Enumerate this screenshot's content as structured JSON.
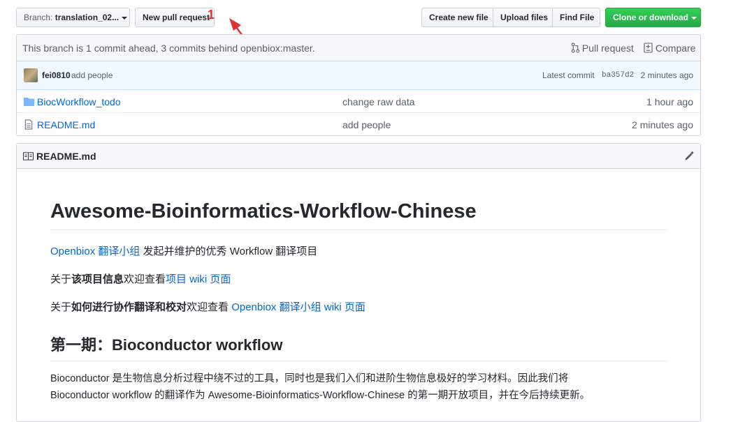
{
  "branch": {
    "prefix": "Branch:",
    "name": "translation_02..."
  },
  "new_pr_label": "New pull request",
  "annotation": {
    "number": "1",
    "color": "#e03131"
  },
  "actions": {
    "create": "Create new file",
    "upload": "Upload files",
    "find": "Find File",
    "clone": "Clone or download"
  },
  "branch_info": {
    "text": "This branch is 1 commit ahead, 3 commits behind openbiox:master.",
    "pull_request": "Pull request",
    "compare": "Compare"
  },
  "commit": {
    "author": "fei0810",
    "message": "add people",
    "latest_label": "Latest commit",
    "sha": "ba357d2",
    "time": "2 minutes ago"
  },
  "files": [
    {
      "name": "BiocWorkflow_todo",
      "type": "folder",
      "message": "change raw data",
      "time": "1 hour ago"
    },
    {
      "name": "README.md",
      "type": "file",
      "message": "add people",
      "time": "2 minutes ago"
    }
  ],
  "readme": {
    "header": "README.md",
    "title": "Awesome-Bioinformatics-Workflow-Chinese",
    "p1_link": "Openbiox 翻译小组",
    "p1_text": " 发起并维护的优秀 Workflow 翻译项目",
    "p2_pre": "关于",
    "p2_bold": "该项目信息",
    "p2_mid": "欢迎查看",
    "p2_link": "项目 wiki 页面",
    "p3_pre": "关于",
    "p3_bold": "如何进行协作翻译和校对",
    "p3_mid": "欢迎查看 ",
    "p3_link": "Openbiox 翻译小组 wiki 页面",
    "h2": "第一期：Bioconductor workflow",
    "p4_line1": "Bioconductor 是生物信息分析过程中绕不过的工具，同时也是我们入们和进阶生物信息极好的学习材料。因此我们将",
    "p4_line2": "Bioconductor workflow 的翻译作为 Awesome-Bioinformatics-Workflow-Chinese 的第一期开放项目，并在今后持续更新。"
  }
}
